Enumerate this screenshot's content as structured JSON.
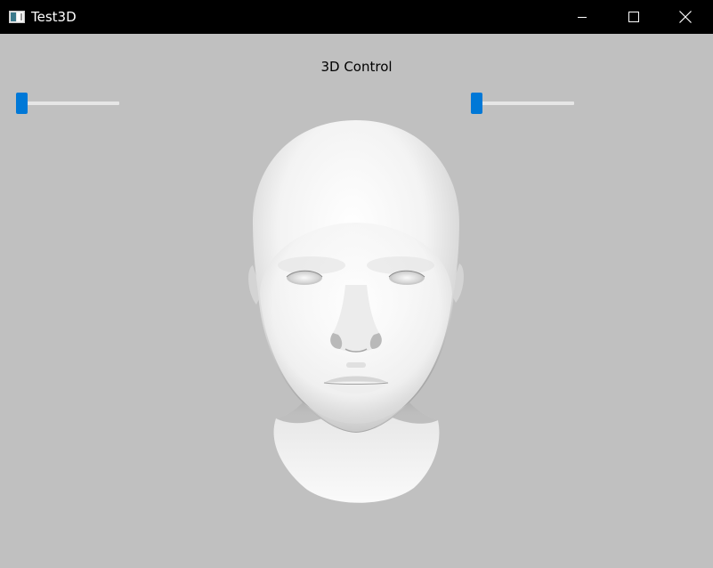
{
  "window": {
    "title": "Test3D",
    "title_bar_color": "#000000",
    "background_color": "#c0c0c0"
  },
  "icons": {
    "app": "app-window-icon",
    "minimize": "minimize-icon",
    "maximize": "maximize-icon",
    "close": "close-icon"
  },
  "control": {
    "title": "3D Control",
    "accent_color": "#0078d7",
    "sliders": [
      {
        "name": "slider-left",
        "value": 0.0
      },
      {
        "name": "slider-right",
        "value": 0.0
      }
    ]
  },
  "viewport": {
    "content": "3d-head-model"
  }
}
